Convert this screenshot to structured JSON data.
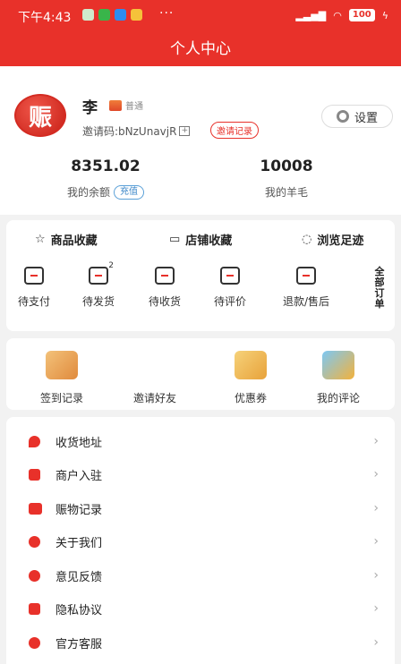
{
  "status_bar": {
    "time": "下午4:43",
    "battery": "100"
  },
  "header": {
    "title": "个人中心"
  },
  "profile": {
    "avatar_text": "赈",
    "name": "李",
    "level": "普通",
    "invite_code": "邀请码:bNzUnavjR",
    "invite_record_label": "邀请记录",
    "settings_label": "设置",
    "balance_value": "8351.02",
    "balance_label": "我的余额",
    "recharge_label": "充值",
    "wool_value": "10008",
    "wool_label": "我的羊毛"
  },
  "tabs": {
    "goods_fav": "商品收藏",
    "shop_fav": "店铺收藏",
    "history": "浏览足迹"
  },
  "orders": {
    "pay": "待支付",
    "ship": "待发货",
    "ship_badge": "2",
    "receive": "待收货",
    "review": "待评价",
    "refund": "退款/售后",
    "all": "全部订单"
  },
  "services": {
    "checkin": "签到记录",
    "invite": "邀请好友",
    "coupon": "优惠券",
    "comments": "我的评论"
  },
  "menu": [
    {
      "label": "收货地址"
    },
    {
      "label": "商户入驻"
    },
    {
      "label": "赈物记录"
    },
    {
      "label": "关于我们"
    },
    {
      "label": "意见反馈"
    },
    {
      "label": "隐私协议"
    },
    {
      "label": "官方客服"
    }
  ],
  "colors": {
    "primary": "#e8312a"
  }
}
